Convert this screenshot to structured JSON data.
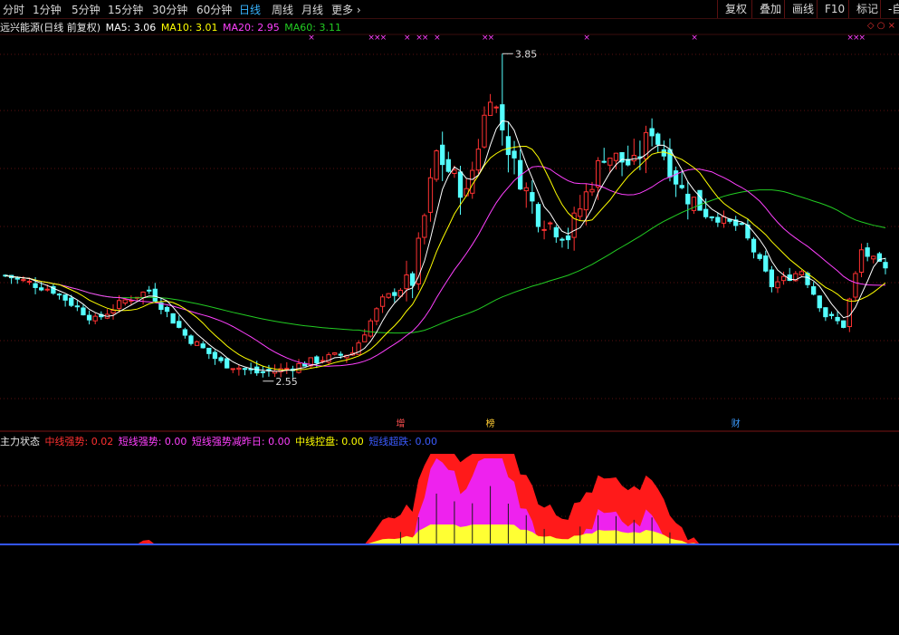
{
  "toolbar": {
    "periods": [
      "分时",
      "1分钟",
      "5分钟",
      "15分钟",
      "30分钟",
      "60分钟",
      "日线",
      "周线",
      "月线",
      "更多 ›"
    ],
    "active_period": "日线",
    "buttons": [
      "复权",
      "叠加",
      "画线",
      "F10",
      "标记",
      "-自"
    ]
  },
  "legend": {
    "title": "远兴能源(日线 前复权)",
    "ma5_label": "MA5: 3.06",
    "ma10_label": "MA10: 3.01",
    "ma20_label": "MA20: 2.95",
    "ma60_label": "MA60: 3.11"
  },
  "colors": {
    "up": "#ff3232",
    "down": "#54ffff",
    "ma5": "#ffffff",
    "ma10": "#ffff00",
    "ma20": "#ff40ff",
    "ma60": "#22cc22",
    "grid": "#5a1010"
  },
  "price_annotations": {
    "high": "3.85",
    "low": "2.55"
  },
  "event_tags": [
    {
      "label": "增",
      "bar": 66,
      "color": "#ff5050"
    },
    {
      "label": "榜",
      "bar": 81,
      "color": "#ffcc33"
    },
    {
      "label": "财",
      "bar": 122,
      "color": "#3b9bff"
    }
  ],
  "right_icons": "◇ ○ ×",
  "indicator": {
    "name": "主力状态",
    "mid_strong": "中线强势: 0.02",
    "short_strong": "短线强势: 0.00",
    "short_weak_reduce": "短线强势减昨日: 0.00",
    "mid_control": "中线控盘: 0.00",
    "short_surge": "短线超跌: 0.00"
  },
  "chart_data": {
    "type": "candlestick",
    "title": "远兴能源(日线 前复权)",
    "y_range": [
      2.4,
      3.92
    ],
    "max_price": 3.85,
    "min_price": 2.55,
    "x_count": 148,
    "anchors_close": [
      [
        0,
        2.96
      ],
      [
        8,
        2.9
      ],
      [
        15,
        2.78
      ],
      [
        20,
        2.86
      ],
      [
        24,
        2.9
      ],
      [
        30,
        2.72
      ],
      [
        36,
        2.61
      ],
      [
        42,
        2.57
      ],
      [
        46,
        2.58
      ],
      [
        52,
        2.62
      ],
      [
        58,
        2.65
      ],
      [
        63,
        2.86
      ],
      [
        68,
        2.94
      ],
      [
        72,
        3.45
      ],
      [
        77,
        3.28
      ],
      [
        81,
        3.7
      ],
      [
        85,
        3.4
      ],
      [
        89,
        3.2
      ],
      [
        94,
        3.12
      ],
      [
        100,
        3.45
      ],
      [
        105,
        3.4
      ],
      [
        108,
        3.55
      ],
      [
        113,
        3.3
      ],
      [
        118,
        3.2
      ],
      [
        123,
        3.15
      ],
      [
        128,
        2.92
      ],
      [
        133,
        2.98
      ],
      [
        137,
        2.8
      ],
      [
        140,
        2.76
      ],
      [
        143,
        3.06
      ],
      [
        147,
        2.98
      ]
    ],
    "indicator_series": {
      "mid_strong": "red area",
      "short_strong": "magenta area",
      "mid_control": "yellow area",
      "short_surge": "blue line"
    }
  }
}
